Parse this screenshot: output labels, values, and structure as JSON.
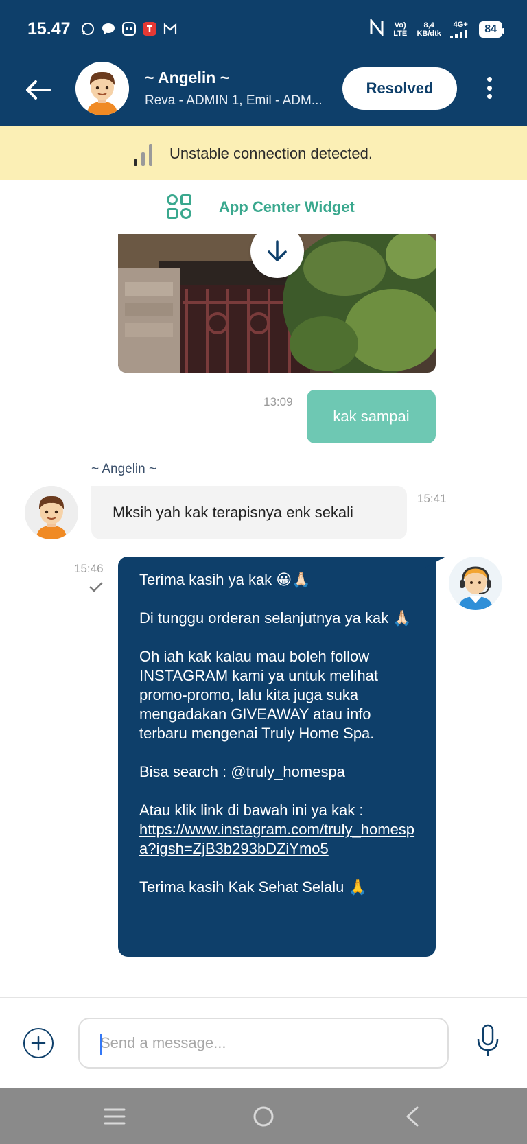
{
  "status_bar": {
    "time": "15.47",
    "net_label": "Vo) LTE",
    "speed": "8,4 KB/dtk",
    "network": "4G+",
    "battery": "84"
  },
  "header": {
    "title": "~ Angelin ~",
    "subtitle": "Reva - ADMIN 1, Emil - ADM...",
    "resolved_label": "Resolved"
  },
  "banner": {
    "warning_text": "Unstable connection detected."
  },
  "widget": {
    "label": "App Center Widget"
  },
  "messages": [
    {
      "type": "image"
    },
    {
      "type": "sent",
      "time": "13:09",
      "text": "kak sampai"
    },
    {
      "type": "received",
      "sender": "~ Angelin ~",
      "time": "15:41",
      "text": "Mksih yah kak terapisnya enk sekali"
    },
    {
      "type": "agent",
      "time": "15:46",
      "lines": [
        "Terima kasih ya kak 😀🙏🏻",
        "Di tunggu orderan selanjutnya ya kak 🙏🏻",
        "Oh iah kak kalau mau boleh follow INSTAGRAM kami ya untuk melihat promo-promo, lalu kita juga suka mengadakan GIVEAWAY atau info terbaru mengenai Truly Home Spa.",
        "Bisa search  : @truly_homespa",
        "Atau klik link di bawah ini ya kak :",
        "https://www.instagram.com/truly_homespa?igsh=ZjB3b293bDZiYmo5",
        "Terima kasih Kak Sehat Selalu 🙏"
      ]
    }
  ],
  "composer": {
    "placeholder": "Send a message..."
  },
  "colors": {
    "primary": "#0e3f6a",
    "sent_bubble": "#6ec8b3",
    "accent_green": "#3aa88e",
    "warning_bg": "#fbefb5"
  }
}
